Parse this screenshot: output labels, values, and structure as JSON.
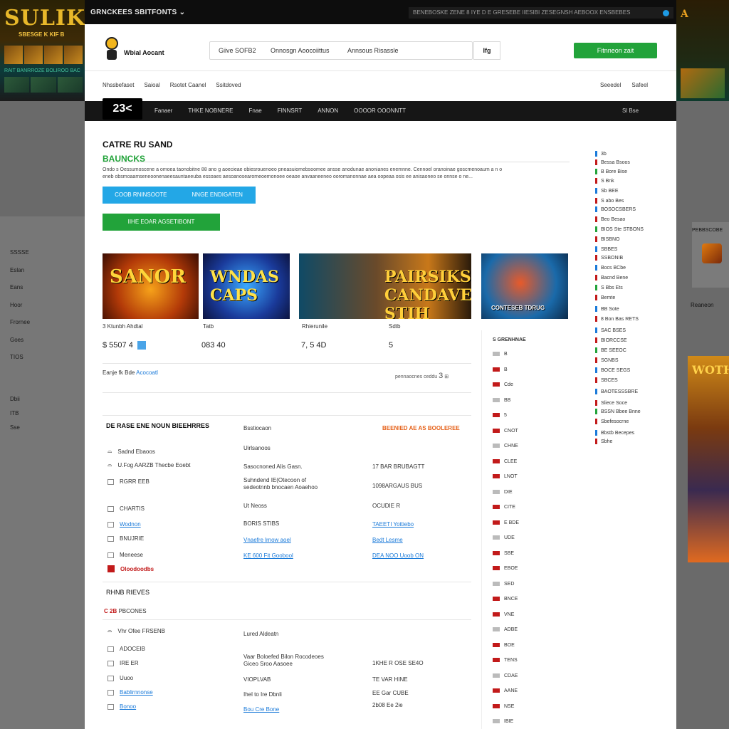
{
  "top_bar": {
    "brand_menu": "GRNCKEES SBITFONTS",
    "ticker": "BENEBOSKE ZENE 8 IYE D E GRESEBE IIESIBI ZESEGNSH AEBOOX ENSBEBES",
    "left_banner_title": "SULIK",
    "left_banner_sub": "SBESGE K KIF B",
    "left_banner_line": "RAIT BANRROZE BOLIROO BAC",
    "right_banner_title": "A"
  },
  "header": {
    "logo_text": "Wbial Aocant",
    "search_segments": [
      "Giive SOFB2",
      "Onnosgn Aoocoiittus",
      "Annsous Risassle"
    ],
    "search_button": "Ifg",
    "cta": "Fitnneon zait"
  },
  "subnav": {
    "links": [
      "Nhssbefaset",
      "Saioal",
      "Rsotet Caanel",
      "Ssitdoved"
    ],
    "right": [
      "Seeedel",
      "Safeel"
    ]
  },
  "navbar": {
    "badge": "23<",
    "items": [
      "Fanaer",
      "THKE NOBNERE",
      "Fnae",
      "FINNSRT",
      "ANNON",
      "OOOOR OOONNTT"
    ],
    "tail": "Sl Bse"
  },
  "hero": {
    "title": "CATRE RU SAND",
    "subtitle": "BAUNCKS",
    "text": "Ondo s Oessumoscene a omoea taonobitne 88 ano g aoecieae obiesrouenoeo pneasuiomebsoomee ansse anodunae anonianes enemnne. Cennoel oranoinae goscmenoaum a n o eneb obsmoaamseneoonenaeesauntaeeuba essoaes aesoanosearomeoemonoee oeaoe anvaaneeneo ooromanonnae aea oopeaa osis ee anisaoneo se onnse o ne...",
    "blue_button_1": "COOB RNINSOOTE",
    "blue_button_2": "NNGE ENDIGATEN",
    "green_button": "IIHE EOAR AGSETIBONT"
  },
  "cards": [
    {
      "art": "SANOR",
      "name": "3 Ktunbh Ahdtal",
      "price": "$ 5507 4"
    },
    {
      "art": "WNDAS CAPS",
      "name": "Tatb",
      "price": "083 40"
    },
    {
      "art": "PAIRSIKS CANDAVE STIH",
      "name": "Rhierunile",
      "price": "7, 5 4D"
    },
    {
      "art": "CONTESEB TDRUG",
      "name": "Sdtb",
      "price": "5"
    }
  ],
  "crumb": {
    "text": "Eanje fk Bde",
    "link": "Acocoatl"
  },
  "crumb_right": "pennaocnes ceddu",
  "crumb_right_num": "3",
  "section1": {
    "title": "DE RASE ENE NOUN BIEEHRRES",
    "mid_header": "Bsstiocaon",
    "orange": "BEENIED AE AS BOOLEREE",
    "rows": [
      {
        "left": "Sadnd Ebaoos",
        "mid": "Uirlsanoos",
        "right": ""
      },
      {
        "left": "U.Fog AARZB Thecbe Eoebt",
        "mid": "Sasocnoned Alis Gasn.",
        "right": "17 BAR BRUBAGTT"
      },
      {
        "left": "RGRR EEB",
        "mid": "Suhndend IE(Otecoon of sedeotnnb bnocaen Aoaehoo",
        "right": "1098ARGAUS BUS"
      },
      {
        "left": "CHARTIS",
        "mid": "Ut Neoss",
        "right": "OCUDIE R"
      },
      {
        "left": "Wodnon",
        "mid": "BORIS STIBS",
        "right": "TAEETI Yottiebo"
      },
      {
        "left": "BNUJRIE",
        "mid": "Vnaefre lrnow aoel",
        "right": "Bedt Lesme"
      },
      {
        "left": "Meneese",
        "mid": "KE 600 Fit Goobool",
        "right": "DEA NOO Uoob ON"
      },
      {
        "left": "Oloodoodbs",
        "mid": "",
        "right": ""
      }
    ]
  },
  "section2": {
    "title": "RHNB RIEVES",
    "sub_code": "C 2B",
    "sub_text": "PBCONES",
    "rows": [
      {
        "left": "Vhr Ofee FRSENB",
        "mid": "Lured Aldeatn",
        "right": ""
      },
      {
        "left": "ADOCEIB",
        "mid": "Vaar Boloefed Bilon Rocodeoes Giceo Sroo Aasoee",
        "right": "1KHE R OSE SE4O"
      },
      {
        "left": "IRE ER",
        "mid": "",
        "right": ""
      },
      {
        "left": "Uuoo",
        "mid": "VIOPLVAB",
        "right": "TE VAR HINE"
      },
      {
        "left": "Bablirnnonse",
        "mid": "Ihel to Ire Dbnli",
        "right": "EE Gar CUBE"
      },
      {
        "left": "Bonoo",
        "mid": "Bou Cre Bone",
        "right": "2b08 Ee 2ie"
      }
    ]
  },
  "side_list": [
    "3b",
    "Bessa Bsoos",
    "B Bore Bise",
    "S Bnk",
    "Sb BEE",
    "S abo Bes",
    "BOSOCSBERS",
    "Beo Besao",
    "BIOS Ste STBONS",
    "BISBNO",
    "SBBES",
    "SSBONIB",
    "Bocs BCbe",
    "Bacnd Bene",
    "S Bbs Ets",
    "Bemte",
    "BB Sote",
    "8 Bon Bas RETS",
    "SAC BSES",
    "BIORCCSE",
    "BE SEEOC",
    "SGNBS",
    "BOCE SEGS",
    "SBCES",
    "BAOTESSSBRE",
    "Sliece Soce",
    "BSSN Bbee Bnne",
    "Sbefesocrne",
    "Bbstb Becepes",
    "Sbhe"
  ],
  "col2_header": "S GRENHNAE",
  "col2_list": [
    "B",
    "B",
    "Cde",
    "BB",
    "5",
    "CNOT",
    "CHNE",
    "CLEE",
    "LNOT",
    "DIE",
    "CITE",
    "E BDE",
    "UDE",
    "SBE",
    "EBOE",
    "SED",
    "BNCE",
    "VNE",
    "ADBE",
    "BOE",
    "TENS",
    "CDAE",
    "AANE",
    "NSE",
    "IBIE"
  ],
  "bg_left_list": [
    "SSSSE",
    "Eslan",
    "Eans",
    "Hoor",
    "Frornee",
    "Goes",
    "TIOS"
  ],
  "bg_left_list2": [
    "Dbii",
    "ITB",
    "Sse"
  ],
  "bg_right": {
    "card_title": "PEBBSCOBE",
    "label": "Reaneon",
    "poster": "WOTH"
  },
  "colors": {
    "accent_green": "#22a33a",
    "accent_blue": "#23a7e6",
    "accent_orange": "#e6621a",
    "nav_dark": "#161616"
  }
}
